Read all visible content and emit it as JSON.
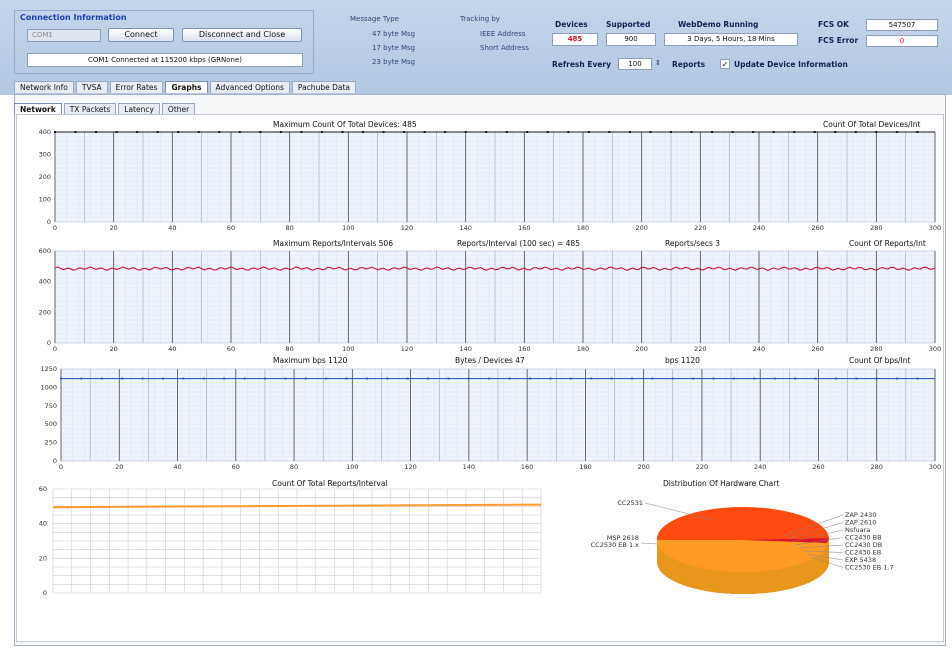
{
  "connection": {
    "title": "Connection Information",
    "port": "COM1",
    "connect_label": "Connect",
    "disconnect_label": "Disconnect and Close",
    "status": "COM1 Connected at 115200 kbps (GRNone)"
  },
  "message_type": {
    "title": "Message Type",
    "items": [
      "47 byte Msg",
      "17 byte Msg",
      "23 byte Msg"
    ]
  },
  "tracking": {
    "title": "Tracking by",
    "items": [
      "IEEE Address",
      "Short Address"
    ]
  },
  "stats": {
    "devices_label": "Devices",
    "devices_value": "485",
    "supported_label": "Supported",
    "supported_value": "900",
    "running_label": "WebDemo Running",
    "running_value": "3 Days, 5 Hours, 18 Mins",
    "fcs_ok_label": "FCS OK",
    "fcs_ok_value": "547507",
    "fcs_error_label": "FCS Error",
    "fcs_error_value": "0",
    "refresh_label": "Refresh Every",
    "refresh_value": "100",
    "reports_label": "Reports",
    "update_label": "Update Device Information"
  },
  "tabs": [
    "Network Info",
    "TVSA",
    "Error Rates",
    "Graphs",
    "Advanced Options",
    "Pachube Data"
  ],
  "subtabs": [
    "Network",
    "TX Packets",
    "Latency",
    "Other"
  ],
  "colors": {
    "red": "#d01040",
    "blue": "#3060c0",
    "orange": "#ff9a2e",
    "accent_red": "#e0102a"
  },
  "charts": {
    "c1": {
      "title": "Maximum Count Of Total Devices: 485",
      "right": "Count Of Total Devices/Int"
    },
    "c2": {
      "t1": "Maximum Reports/Intervals 506",
      "t2": "Reports/Interval (100 sec) = 485",
      "t3": "Reports/secs 3",
      "right": "Count Of Reports/Int"
    },
    "c3": {
      "t1": "Maximum bps 1120",
      "t2": "Bytes / Devices 47",
      "t3": "bps 1120",
      "right": "Count Of bps/Int"
    },
    "c4": {
      "title": "Count Of Total Reports/Interval"
    },
    "c5": {
      "title": "Distribution Of Hardware Chart"
    }
  },
  "chart_data": [
    {
      "type": "line",
      "x": {
        "min": 0,
        "max": 300,
        "ticks": [
          0,
          20,
          40,
          60,
          80,
          100,
          120,
          140,
          160,
          180,
          200,
          220,
          240,
          260,
          280,
          300
        ]
      },
      "ylim": [
        0,
        400
      ],
      "yticks": [
        0,
        100,
        200,
        300,
        400
      ],
      "series": [
        {
          "values": "constant 400"
        }
      ]
    },
    {
      "type": "line",
      "x": {
        "min": 0,
        "max": 300,
        "ticks": [
          0,
          20,
          40,
          60,
          80,
          100,
          120,
          140,
          160,
          180,
          200,
          220,
          240,
          260,
          280,
          300
        ]
      },
      "ylim": [
        0,
        600
      ],
      "yticks": [
        0,
        200,
        400,
        600
      ],
      "series": [
        {
          "values": "approx 485"
        }
      ]
    },
    {
      "type": "line",
      "x": {
        "min": 0,
        "max": 300,
        "ticks": [
          0,
          20,
          40,
          60,
          80,
          100,
          120,
          140,
          160,
          180,
          200,
          220,
          240,
          260,
          280,
          300
        ]
      },
      "ylim": [
        0,
        1250
      ],
      "yticks": [
        0,
        250,
        500,
        750,
        1000,
        1250
      ],
      "series": [
        {
          "values": "approx 1120"
        }
      ]
    },
    {
      "type": "line",
      "ylim": [
        0,
        60
      ],
      "yticks": [
        0,
        20,
        40,
        60
      ],
      "series": [
        {
          "values": "approx 50"
        }
      ]
    },
    {
      "type": "pie",
      "labels": [
        "ZAP 2430",
        "ZAP 2610",
        "Nsfuara",
        "CC2430 BB",
        "CC2430 DB",
        "CC2430 EB",
        "EXP 5438",
        "CC2530 EB 1.7",
        "CC2531",
        "MSP 2618",
        "CC2530 EB 1.x"
      ]
    }
  ]
}
